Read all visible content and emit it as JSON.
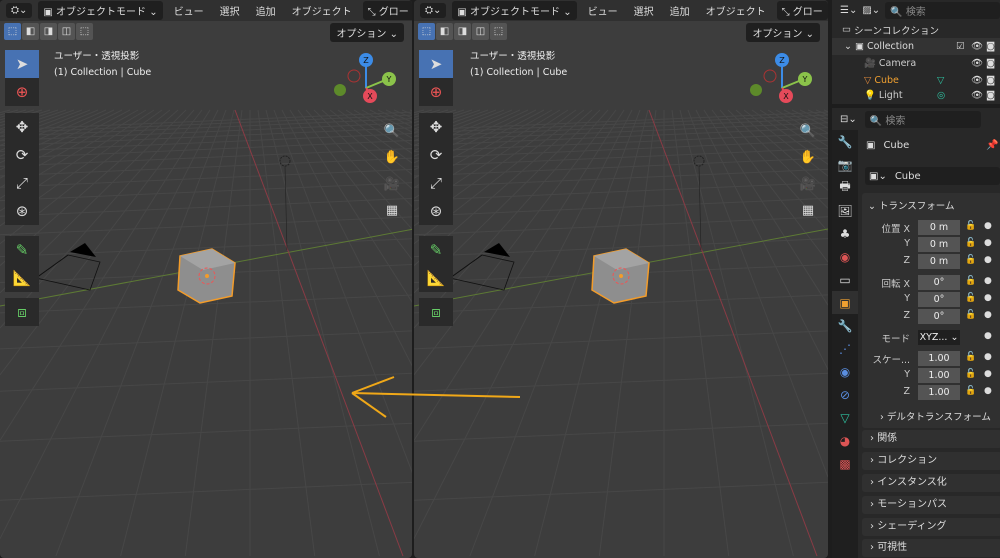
{
  "viewport": {
    "mode": "オブジェクトモード",
    "menus": [
      "ビュー",
      "選択",
      "追加",
      "オブジェクト"
    ],
    "orientation": "グロー",
    "options": "オプション",
    "view_name": "ユーザー・透視投影",
    "context": "(1) Collection | Cube",
    "axes": {
      "x": "X",
      "y": "Y",
      "z": "Z"
    }
  },
  "outliner": {
    "search_placeholder": "検索",
    "scene_collection": "シーンコレクション",
    "collection": "Collection",
    "items": [
      {
        "name": "Camera",
        "color": "#cccccc"
      },
      {
        "name": "Cube",
        "color": "#f0a030"
      },
      {
        "name": "Light",
        "color": "#cccccc"
      }
    ]
  },
  "properties": {
    "search_placeholder": "検索",
    "object_name": "Cube",
    "object_field": "Cube",
    "transform": {
      "title": "トランスフォーム",
      "location_label": "位置",
      "rotation_label": "回転",
      "mode_label": "モード",
      "mode_value": "XYZ...",
      "scale_label": "スケー...",
      "location": [
        "0 m",
        "0 m",
        "0 m"
      ],
      "rotation": [
        "0°",
        "0°",
        "0°"
      ],
      "scale": [
        "1.00",
        "1.00",
        "1.00"
      ],
      "axes": [
        "X",
        "Y",
        "Z"
      ],
      "delta": "デルタトランスフォーム"
    },
    "sections": [
      "関係",
      "コレクション",
      "インスタンス化",
      "モーションパス",
      "シェーディング",
      "可視性"
    ]
  },
  "colors": {
    "accent": "#4772b3",
    "selected": "#f0a030",
    "arrow": "#f0a818"
  }
}
